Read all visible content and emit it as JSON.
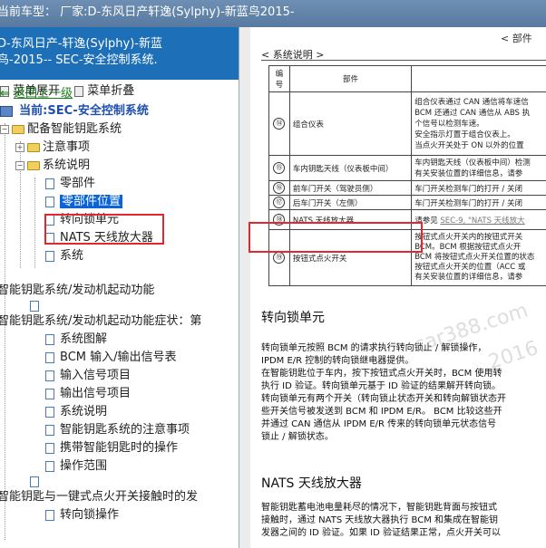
{
  "window": {
    "title": "当前车型：  厂家:D-东风日产轩逸(Sylphy)-新蓝鸟2015-"
  },
  "left": {
    "header_line1": "D-东风日产-轩逸(Sylphy)-新蓝",
    "header_line2": "鸟-2015-- SEC-安全控制系统.",
    "expand_label": "菜单展开",
    "collapse_label": "菜单折叠",
    "back_label": "返回上一级",
    "current_label": "当前:SEC-安全控制系统",
    "tree": {
      "n1": "配备智能钥匙系统",
      "n2": "注意事项",
      "n3": "系统说明",
      "n4": "零部件",
      "n5": "零部件位置",
      "n6": "转向锁单元",
      "n7": "NATS 天线放大器",
      "n8": "系统",
      "n9": "智能钥匙系统/发动机起动功能",
      "n10": "智能钥匙系统/发动机起动功能症状：第",
      "n11": "系统图解",
      "n12": "BCM 输入/输出信号表",
      "n13": "输入信号项目",
      "n14": "输出信号项目",
      "n15": "系统说明",
      "n16": "智能钥匙系统的注意事项",
      "n17": "携带智能钥匙时的操作",
      "n18": "操作范围",
      "n19": "智能钥匙与一键式点火开关接触时的发",
      "n20": "转向锁操作"
    }
  },
  "doc": {
    "section_title": "< 系统说明 >",
    "corner": "< 部件",
    "table_header_num": "编号",
    "table_header_part": "部件",
    "rows": [
      {
        "num": "⑭",
        "part": "组合仪表",
        "desc1": "组合仪表通过 CAN 通信将车速信",
        "desc2": "BCM 还通过 CAN 通信从 ABS 执",
        "desc3": "个信号以检测车速。",
        "desc4": "安全指示灯置于组合仪表上。",
        "desc5": "当点火开关处于 ON 以外的位置"
      },
      {
        "num": "⑮",
        "part": "车内钥匙天线（仪表板中间）",
        "desc1": "车内钥匙天线（仪表板中间）检测",
        "desc2": "有关安装位置的详细信息，请参"
      },
      {
        "num": "⑯",
        "part": "前车门开关（驾驶员侧）",
        "desc1": "车门开关检测车门的打开 / 关闭"
      },
      {
        "num": "⑰",
        "part": "后车门开关（左侧）",
        "desc1": "车门开关检测车门的打开 / 关闭"
      },
      {
        "num": "⑱",
        "part": "NATS 天线放大器",
        "desc1": "请参见 ",
        "link": "SEC-9, \"NATS 天线放大"
      },
      {
        "num": "⑲",
        "part": "按钮式点火开关",
        "desc1": "按钮式点火开关内的按钮式开关",
        "desc2": "BCM。BCM 根据按钮式点火开",
        "desc3": "BCM 将按钮式点火开关位置的状态",
        "desc4": "按钮式点火开关的位置（ACC 或",
        "desc5": "有关安装位置的详细信息，请参"
      }
    ],
    "h_steering": "转向锁单元",
    "p1": "转向锁单元按照 BCM 的请求执行转向锁止 / 解锁操作，",
    "p2": "IPDM E/R 控制的转向锁继电器提供。",
    "p3": "在智能钥匙位于车内，按下按钮式点火开关时，BCM 使用转",
    "p4": "执行 ID 验证。转向锁单元基于 ID 验证的结果解开转向锁。",
    "p5": "转向锁单元有两个开关（转向锁止状态开关和转向解锁状态开",
    "p6": "些开关信号被发送到 BCM 和 IPDM E/R。 BCM 比较这些开",
    "p7": "并通过 CAN 通信从 IPDM E/R 传来的转向锁单元状态信号",
    "p8": "锁止 / 解锁状态。",
    "h_nats": "NATS 天线放大器",
    "p9": "智能钥匙蓄电池电量耗尽的情况下，智能钥匙背面与按钮式",
    "p10": "接触时，通过 NATS 天线放大器执行 BCM 和集成在智能钥",
    "p11": "发器之间的 ID 验证。如果 ID 验证结果正常，点火开关可以",
    "watermark1": "car388.com",
    "watermark2": "2016"
  }
}
